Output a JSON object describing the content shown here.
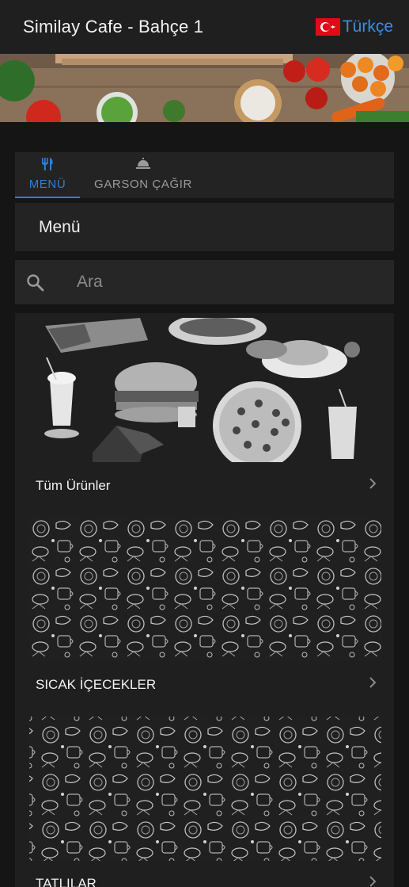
{
  "header": {
    "title": "Similay Cafe - Bahçe 1",
    "language_label": "Türkçe",
    "flag_icon": "turkey-flag-icon"
  },
  "tabs": [
    {
      "label": "MENÜ",
      "icon": "cutlery-icon",
      "active": true
    },
    {
      "label": "GARSON ÇAĞIR",
      "icon": "service-bell-icon",
      "active": false
    }
  ],
  "section_title": "Menü",
  "search": {
    "placeholder": "Ara"
  },
  "categories": [
    {
      "label": "Tüm Ürünler",
      "image": "food-collage-image"
    },
    {
      "label": "SICAK İÇECEKLER",
      "image": "doodle-pattern-image"
    },
    {
      "label": "TATLILAR",
      "image": "doodle-pattern-image"
    }
  ],
  "colors": {
    "accent": "#2f7fd4",
    "language_link": "#3a8dde",
    "background": "#151515",
    "card": "#232323"
  }
}
